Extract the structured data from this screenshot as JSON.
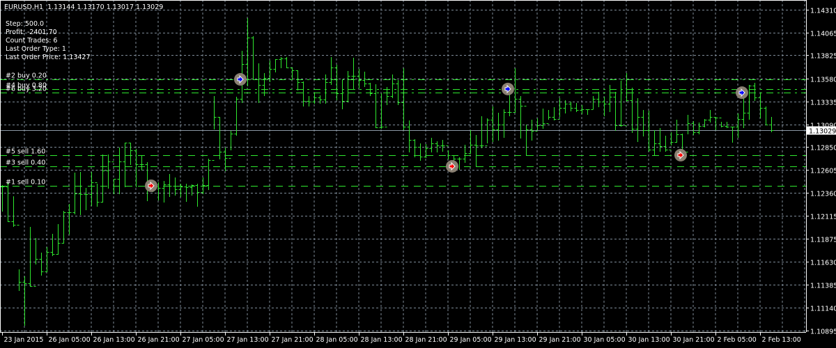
{
  "header": {
    "title": "EURUSD,H1  1.13144 1.13170 1.13017 1.13029"
  },
  "info": {
    "step": "Step: 500.0",
    "profit": "Profit: -2401.70",
    "count_trades": "Count Trades: 6",
    "last_order_type": "Last Order Type: 1",
    "last_order_price": "Last Order Price: 1.13427"
  },
  "colors": {
    "background": "#000000",
    "bars": "#2ee82e",
    "grid": "#7f8c99",
    "order_lines": "#2ee82e",
    "price_line": "#8a97a4",
    "buy_arrow": "#0000ff",
    "sell_arrow": "#ff0000",
    "marker_circle": "#8a8072"
  },
  "chart_data": {
    "type": "ohlc",
    "symbol": "EURUSD",
    "timeframe": "H1",
    "ylim": [
      1.10879,
      1.14414
    ],
    "current_price": "1.13029",
    "y_ticks": [
      "1.14310",
      "1.14065",
      "1.13825",
      "1.13580",
      "1.13335",
      "1.13090",
      "1.12850",
      "1.12605",
      "1.12360",
      "1.12115",
      "1.11875",
      "1.11630",
      "1.11385",
      "1.11140",
      "1.10895"
    ],
    "x_tick_labels": [
      "23 Jan 2015",
      "26 Jan 05:00",
      "26 Jan 13:00",
      "26 Jan 21:00",
      "27 Jan 05:00",
      "27 Jan 13:00",
      "27 Jan 21:00",
      "28 Jan 05:00",
      "28 Jan 13:00",
      "28 Jan 21:00",
      "29 Jan 05:00",
      "29 Jan 13:00",
      "29 Jan 21:00",
      "30 Jan 05:00",
      "30 Jan 13:00",
      "30 Jan 21:00",
      "2 Feb 05:00",
      "2 Feb 13:00"
    ],
    "x_tick_every_bars": 8,
    "bars_hlc": [
      [
        1.12443,
        1.12169,
        1.12428
      ],
      [
        1.12465,
        1.12058,
        1.12058
      ],
      [
        1.12324,
        1.12006,
        1.12021
      ],
      [
        1.11546,
        1.11324,
        1.11413
      ],
      [
        1.11472,
        1.10953,
        1.11398
      ],
      [
        1.11998,
        1.11368,
        1.11368
      ],
      [
        1.1188,
        1.11606,
        1.11657
      ],
      [
        1.11724,
        1.11487,
        1.11524
      ],
      [
        1.11783,
        1.11524,
        1.11732
      ],
      [
        1.11924,
        1.11695,
        1.11709
      ],
      [
        1.12028,
        1.11709,
        1.11824
      ],
      [
        1.12169,
        1.11824,
        1.12154
      ],
      [
        1.12243,
        1.11924,
        1.12154
      ],
      [
        1.12576,
        1.12139,
        1.12354
      ],
      [
        1.12584,
        1.12132,
        1.12347
      ],
      [
        1.12413,
        1.12184,
        1.12347
      ],
      [
        1.12584,
        1.12228,
        1.12473
      ],
      [
        1.12458,
        1.12221,
        1.12265
      ],
      [
        1.12769,
        1.12265,
        1.12599
      ],
      [
        1.12769,
        1.12413,
        1.12695
      ],
      [
        1.1251,
        1.12354,
        1.1251
      ],
      [
        1.12843,
        1.12354,
        1.12695
      ],
      [
        1.12895,
        1.12428,
        1.12895
      ],
      [
        1.12895,
        1.12665,
        1.12813
      ],
      [
        1.12828,
        1.12428,
        1.12665
      ],
      [
        1.12754,
        1.12606,
        1.12665
      ],
      [
        1.12688,
        1.1228,
        1.12473
      ],
      [
        1.12488,
        1.12376,
        1.12428
      ],
      [
        1.12473,
        1.12287,
        1.12413
      ],
      [
        1.12488,
        1.12265,
        1.12451
      ],
      [
        1.12561,
        1.12324,
        1.12436
      ],
      [
        1.12524,
        1.12339,
        1.12399
      ],
      [
        1.12458,
        1.12324,
        1.12428
      ],
      [
        1.12458,
        1.12273,
        1.12421
      ],
      [
        1.12451,
        1.12339,
        1.12443
      ],
      [
        1.12458,
        1.12221,
        1.12369
      ],
      [
        1.12524,
        1.12354,
        1.12443
      ],
      [
        1.12725,
        1.12399,
        1.1271
      ],
      [
        1.13392,
        1.13043,
        1.13169
      ],
      [
        1.13169,
        1.12725,
        1.12799
      ],
      [
        1.12843,
        1.12599,
        1.12732
      ],
      [
        1.13021,
        1.12821,
        1.12991
      ],
      [
        1.13384,
        1.12976,
        1.13362
      ],
      [
        1.13873,
        1.13325,
        1.13732
      ],
      [
        1.14221,
        1.13503,
        1.14014
      ],
      [
        1.14029,
        1.13569,
        1.13569
      ],
      [
        1.1374,
        1.13325,
        1.1351
      ],
      [
        1.13636,
        1.13399,
        1.13584
      ],
      [
        1.13769,
        1.13547,
        1.1368
      ],
      [
        1.13784,
        1.13651,
        1.13784
      ],
      [
        1.13806,
        1.13695,
        1.13792
      ],
      [
        1.13806,
        1.13695,
        1.13695
      ],
      [
        1.13695,
        1.13569,
        1.13666
      ],
      [
        1.13666,
        1.13458,
        1.1354
      ],
      [
        1.13547,
        1.13288,
        1.1334
      ],
      [
        1.13392,
        1.13288,
        1.13332
      ],
      [
        1.13421,
        1.13317,
        1.13377
      ],
      [
        1.13399,
        1.13317,
        1.13354
      ],
      [
        1.13621,
        1.13317,
        1.1354
      ],
      [
        1.13806,
        1.13517,
        1.13695
      ],
      [
        1.13725,
        1.13354,
        1.13421
      ],
      [
        1.13569,
        1.13258,
        1.1334
      ],
      [
        1.13658,
        1.13332,
        1.13606
      ],
      [
        1.13799,
        1.13473,
        1.13606
      ],
      [
        1.1368,
        1.1348,
        1.13562
      ],
      [
        1.13651,
        1.13495,
        1.13525
      ],
      [
        1.13532,
        1.13399,
        1.13421
      ],
      [
        1.13517,
        1.13058,
        1.13058
      ],
      [
        1.13421,
        1.13051,
        1.13065
      ],
      [
        1.13488,
        1.13303,
        1.13392
      ],
      [
        1.13621,
        1.13377,
        1.13525
      ],
      [
        1.13562,
        1.13303,
        1.13325
      ],
      [
        1.13688,
        1.13036,
        1.13065
      ],
      [
        1.13132,
        1.12799,
        1.12925
      ],
      [
        1.12932,
        1.12747,
        1.12851
      ],
      [
        1.12888,
        1.1271,
        1.12747
      ],
      [
        1.1288,
        1.12739,
        1.12836
      ],
      [
        1.12947,
        1.12799,
        1.12888
      ],
      [
        1.1291,
        1.12799,
        1.12865
      ],
      [
        1.12925,
        1.12806,
        1.12865
      ],
      [
        1.12813,
        1.12725,
        1.12762
      ],
      [
        1.12762,
        1.12599,
        1.12725
      ],
      [
        1.12739,
        1.12613,
        1.12725
      ],
      [
        1.12873,
        1.12688,
        1.12784
      ],
      [
        1.13028,
        1.12784,
        1.12873
      ],
      [
        1.12976,
        1.12643,
        1.12865
      ],
      [
        1.13177,
        1.12843,
        1.12865
      ],
      [
        1.13154,
        1.12895,
        1.13139
      ],
      [
        1.1328,
        1.1291,
        1.13036
      ],
      [
        1.13214,
        1.12925,
        1.13088
      ],
      [
        1.13251,
        1.12954,
        1.13221
      ],
      [
        1.13443,
        1.13184,
        1.13221
      ],
      [
        1.13688,
        1.13221,
        1.13362
      ],
      [
        1.13392,
        1.12947,
        1.13288
      ],
      [
        1.13088,
        1.12762,
        1.13036
      ],
      [
        1.13139,
        1.12925,
        1.13021
      ],
      [
        1.13154,
        1.13036,
        1.1308
      ],
      [
        1.13258,
        1.13051,
        1.13102
      ],
      [
        1.13243,
        1.13147,
        1.13169
      ],
      [
        1.13273,
        1.13139,
        1.13147
      ],
      [
        1.13369,
        1.13177,
        1.13266
      ],
      [
        1.13347,
        1.13214,
        1.1331
      ],
      [
        1.13332,
        1.13236,
        1.13266
      ],
      [
        1.13317,
        1.13228,
        1.13243
      ],
      [
        1.13295,
        1.13206,
        1.13251
      ],
      [
        1.13251,
        1.13199,
        1.13251
      ],
      [
        1.13392,
        1.13258,
        1.13362
      ],
      [
        1.13436,
        1.1328,
        1.13332
      ],
      [
        1.13384,
        1.13184,
        1.1331
      ],
      [
        1.1351,
        1.13228,
        1.13384
      ],
      [
        1.13436,
        1.13028,
        1.1308
      ],
      [
        1.13554,
        1.13073,
        1.1308
      ],
      [
        1.13636,
        1.1334,
        1.13347
      ],
      [
        1.1348,
        1.13006,
        1.13043
      ],
      [
        1.13369,
        1.1291,
        1.13169
      ],
      [
        1.13243,
        1.12969,
        1.13028
      ],
      [
        1.13236,
        1.12806,
        1.12821
      ],
      [
        1.13028,
        1.12769,
        1.12888
      ],
      [
        1.13051,
        1.12806,
        1.12858
      ],
      [
        1.12969,
        1.12806,
        1.12821
      ],
      [
        1.13006,
        1.12873,
        1.12902
      ],
      [
        1.13139,
        1.12902,
        1.12984
      ],
      [
        1.12991,
        1.12769,
        1.12799
      ],
      [
        1.13191,
        1.12991,
        1.13102
      ],
      [
        1.13125,
        1.12984,
        1.13006
      ],
      [
        1.1311,
        1.12991,
        1.13073
      ],
      [
        1.13147,
        1.13065,
        1.13139
      ],
      [
        1.13243,
        1.13117,
        1.13169
      ],
      [
        1.13169,
        1.13036,
        1.13162
      ],
      [
        1.13117,
        1.13065,
        1.13073
      ],
      [
        1.13117,
        1.13058,
        1.13065
      ],
      [
        1.13065,
        1.12902,
        1.13065
      ],
      [
        1.13206,
        1.12954,
        1.13147
      ],
      [
        1.13466,
        1.13058,
        1.13214
      ],
      [
        1.1351,
        1.13147,
        1.13503
      ],
      [
        1.13532,
        1.13347,
        1.13377
      ],
      [
        1.13429,
        1.13162,
        1.13266
      ],
      [
        1.1328,
        1.13088,
        1.13088
      ],
      [
        1.1317,
        1.13017,
        1.13029
      ]
    ],
    "orders": [
      {
        "label": "#2 buy 0.20",
        "type": "buy",
        "price": 1.13569
      },
      {
        "label": "#4 buy 0.80",
        "type": "buy",
        "price": 1.13466
      },
      {
        "label": "#6 buy 3.20",
        "type": "buy",
        "price": 1.13427
      },
      {
        "label": "#5 sell 1.60",
        "type": "sell",
        "price": 1.12762
      },
      {
        "label": "#3 sell 0.40",
        "type": "sell",
        "price": 1.12643
      },
      {
        "label": "#1 sell 0.10",
        "type": "sell",
        "price": 1.12436
      }
    ],
    "markers": [
      {
        "type": "sell",
        "bar": 27,
        "price": 1.12436
      },
      {
        "type": "buy",
        "bar": 43,
        "price": 1.13569
      },
      {
        "type": "sell",
        "bar": 81,
        "price": 1.12643
      },
      {
        "type": "buy",
        "bar": 91,
        "price": 1.13466
      },
      {
        "type": "sell",
        "bar": 122,
        "price": 1.12762
      },
      {
        "type": "buy",
        "bar": 133,
        "price": 1.13427
      }
    ]
  }
}
